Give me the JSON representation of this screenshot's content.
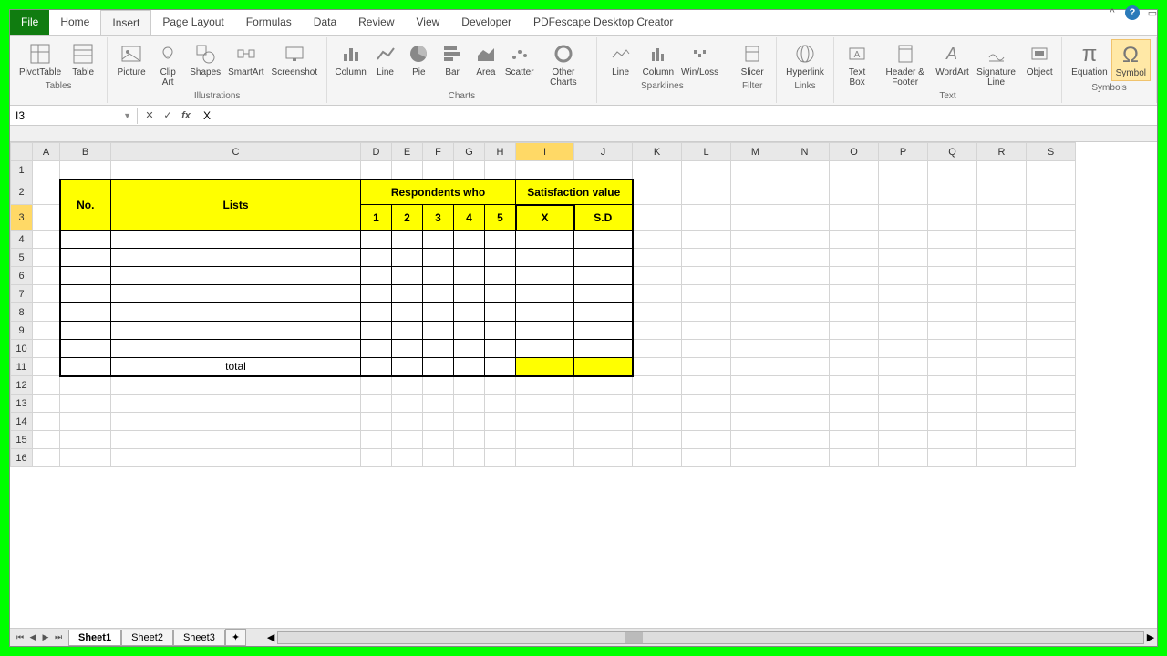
{
  "tabs": {
    "file": "File",
    "home": "Home",
    "insert": "Insert",
    "page_layout": "Page Layout",
    "formulas": "Formulas",
    "data": "Data",
    "review": "Review",
    "view": "View",
    "developer": "Developer",
    "pdfescape": "PDFescape Desktop Creator"
  },
  "ribbon": {
    "tables": {
      "label": "Tables",
      "pivottable": "PivotTable",
      "table": "Table"
    },
    "illustrations": {
      "label": "Illustrations",
      "picture": "Picture",
      "clipart": "Clip\nArt",
      "shapes": "Shapes",
      "smartart": "SmartArt",
      "screenshot": "Screenshot"
    },
    "charts": {
      "label": "Charts",
      "column": "Column",
      "line": "Line",
      "pie": "Pie",
      "bar": "Bar",
      "area": "Area",
      "scatter": "Scatter",
      "other": "Other\nCharts"
    },
    "sparklines": {
      "label": "Sparklines",
      "line": "Line",
      "column": "Column",
      "winloss": "Win/Loss"
    },
    "filter": {
      "label": "Filter",
      "slicer": "Slicer"
    },
    "links": {
      "label": "Links",
      "hyperlink": "Hyperlink"
    },
    "text": {
      "label": "Text",
      "textbox": "Text\nBox",
      "header": "Header\n& Footer",
      "wordart": "WordArt",
      "signature": "Signature\nLine",
      "object": "Object"
    },
    "symbols": {
      "label": "Symbols",
      "equation": "Equation",
      "symbol": "Symbol"
    }
  },
  "formula_bar": {
    "cell_ref": "I3",
    "value": "X"
  },
  "columns": [
    "A",
    "B",
    "C",
    "D",
    "E",
    "F",
    "G",
    "H",
    "I",
    "J",
    "K",
    "L",
    "M",
    "N",
    "O",
    "P",
    "Q",
    "R",
    "S"
  ],
  "rows": [
    "1",
    "2",
    "3",
    "4",
    "5",
    "6",
    "7",
    "8",
    "9",
    "10",
    "11",
    "12",
    "13",
    "14",
    "15",
    "16"
  ],
  "table": {
    "no": "No.",
    "lists": "Lists",
    "respondents": "Respondents who",
    "satisfaction": "Satisfaction value",
    "r1": "1",
    "r2": "2",
    "r3": "3",
    "r4": "4",
    "r5": "5",
    "x": "X",
    "sd": "S.D",
    "total": "total"
  },
  "sheets": {
    "s1": "Sheet1",
    "s2": "Sheet2",
    "s3": "Sheet3"
  },
  "active_cell": "I3",
  "active_col": "I",
  "active_row": "3"
}
